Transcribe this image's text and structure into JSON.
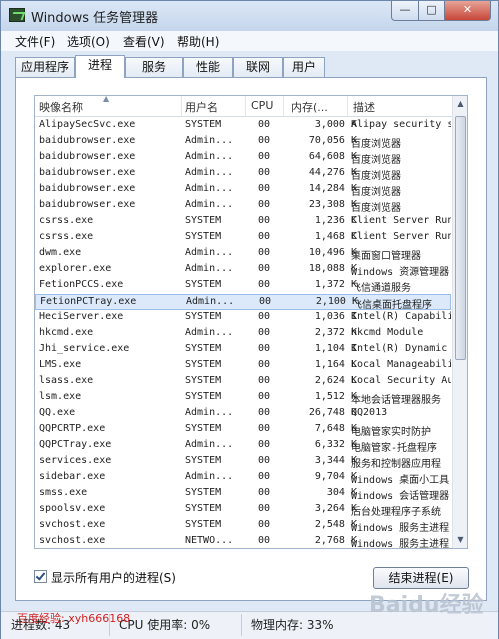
{
  "window": {
    "title": "Windows 任务管理器"
  },
  "title_buttons": {
    "minimize": "—",
    "maximize": "□",
    "close": "✕"
  },
  "menu": [
    "文件(F)",
    "选项(O)",
    "查看(V)",
    "帮助(H)"
  ],
  "tabs": [
    {
      "label": "应用程序",
      "active": false
    },
    {
      "label": "进程",
      "active": true
    },
    {
      "label": "服务",
      "active": false
    },
    {
      "label": "性能",
      "active": false
    },
    {
      "label": "联网",
      "active": false
    },
    {
      "label": "用户",
      "active": false
    }
  ],
  "columns": {
    "name": "映像名称",
    "user": "用户名",
    "cpu": "CPU",
    "mem": "内存(...",
    "desc": "描述"
  },
  "processes": [
    {
      "name": "AlipaySecSvc.exe",
      "user": "SYSTEM",
      "cpu": "00",
      "mem": "3,000 K",
      "desc": "Alipay security s"
    },
    {
      "name": "baidubrowser.exe",
      "user": "Admin...",
      "cpu": "00",
      "mem": "70,056 K",
      "desc": "百度浏览器"
    },
    {
      "name": "baidubrowser.exe",
      "user": "Admin...",
      "cpu": "00",
      "mem": "64,608 K",
      "desc": "百度浏览器"
    },
    {
      "name": "baidubrowser.exe",
      "user": "Admin...",
      "cpu": "00",
      "mem": "44,276 K",
      "desc": "百度浏览器"
    },
    {
      "name": "baidubrowser.exe",
      "user": "Admin...",
      "cpu": "00",
      "mem": "14,284 K",
      "desc": "百度浏览器"
    },
    {
      "name": "baidubrowser.exe",
      "user": "Admin...",
      "cpu": "00",
      "mem": "23,308 K",
      "desc": "百度浏览器"
    },
    {
      "name": "csrss.exe",
      "user": "SYSTEM",
      "cpu": "00",
      "mem": "1,236 K",
      "desc": "Client Server Run"
    },
    {
      "name": "csrss.exe",
      "user": "SYSTEM",
      "cpu": "00",
      "mem": "1,468 K",
      "desc": "Client Server Run"
    },
    {
      "name": "dwm.exe",
      "user": "Admin...",
      "cpu": "00",
      "mem": "10,496 K",
      "desc": "桌面窗口管理器"
    },
    {
      "name": "explorer.exe",
      "user": "Admin...",
      "cpu": "00",
      "mem": "18,088 K",
      "desc": "Windows 资源管理器"
    },
    {
      "name": "FetionPCCS.exe",
      "user": "SYSTEM",
      "cpu": "00",
      "mem": "1,372 K",
      "desc": "飞信通道服务"
    },
    {
      "name": "FetionPCTray.exe",
      "user": "Admin...",
      "cpu": "00",
      "mem": "2,100 K",
      "desc": "飞信桌面托盘程序",
      "selected": true
    },
    {
      "name": "HeciServer.exe",
      "user": "SYSTEM",
      "cpu": "00",
      "mem": "1,036 K",
      "desc": "Intel(R) Capabili"
    },
    {
      "name": "hkcmd.exe",
      "user": "Admin...",
      "cpu": "00",
      "mem": "2,372 K",
      "desc": "hkcmd Module"
    },
    {
      "name": "Jhi_service.exe",
      "user": "SYSTEM",
      "cpu": "00",
      "mem": "1,104 K",
      "desc": "Intel(R) Dynamic"
    },
    {
      "name": "LMS.exe",
      "user": "SYSTEM",
      "cpu": "00",
      "mem": "1,164 K",
      "desc": "Local Manageabili"
    },
    {
      "name": "lsass.exe",
      "user": "SYSTEM",
      "cpu": "00",
      "mem": "2,624 K",
      "desc": "Local Security Au"
    },
    {
      "name": "lsm.exe",
      "user": "SYSTEM",
      "cpu": "00",
      "mem": "1,512 K",
      "desc": "本地会话管理器服务"
    },
    {
      "name": "QQ.exe",
      "user": "Admin...",
      "cpu": "00",
      "mem": "26,748 K",
      "desc": "QQ2013"
    },
    {
      "name": "QQPCRTP.exe",
      "user": "SYSTEM",
      "cpu": "00",
      "mem": "7,648 K",
      "desc": "电脑管家实时防护"
    },
    {
      "name": "QQPCTray.exe",
      "user": "Admin...",
      "cpu": "00",
      "mem": "6,332 K",
      "desc": "电脑管家-托盘程序"
    },
    {
      "name": "services.exe",
      "user": "SYSTEM",
      "cpu": "00",
      "mem": "3,344 K",
      "desc": "服务和控制器应用程"
    },
    {
      "name": "sidebar.exe",
      "user": "Admin...",
      "cpu": "00",
      "mem": "9,704 K",
      "desc": "Windows 桌面小工具"
    },
    {
      "name": "smss.exe",
      "user": "SYSTEM",
      "cpu": "00",
      "mem": "304 K",
      "desc": "Windows 会话管理器"
    },
    {
      "name": "spoolsv.exe",
      "user": "SYSTEM",
      "cpu": "00",
      "mem": "3,264 K",
      "desc": "后台处理程序子系统"
    },
    {
      "name": "svchost.exe",
      "user": "SYSTEM",
      "cpu": "00",
      "mem": "2,548 K",
      "desc": "Windows 服务主进程"
    },
    {
      "name": "svchost.exe",
      "user": "NETWO...",
      "cpu": "00",
      "mem": "2,768 K",
      "desc": "Windows 服务主进程"
    }
  ],
  "show_all_processes": {
    "label": "显示所有用户的进程(S)",
    "checked": true
  },
  "end_process_button": "结束进程(E)",
  "status": {
    "processes": "进程数: 43",
    "cpu": "CPU 使用率: 0%",
    "memory": "物理内存: 33%"
  },
  "watermark": {
    "text": "百度经验: xyh666168",
    "logo": "Baidu经验"
  }
}
